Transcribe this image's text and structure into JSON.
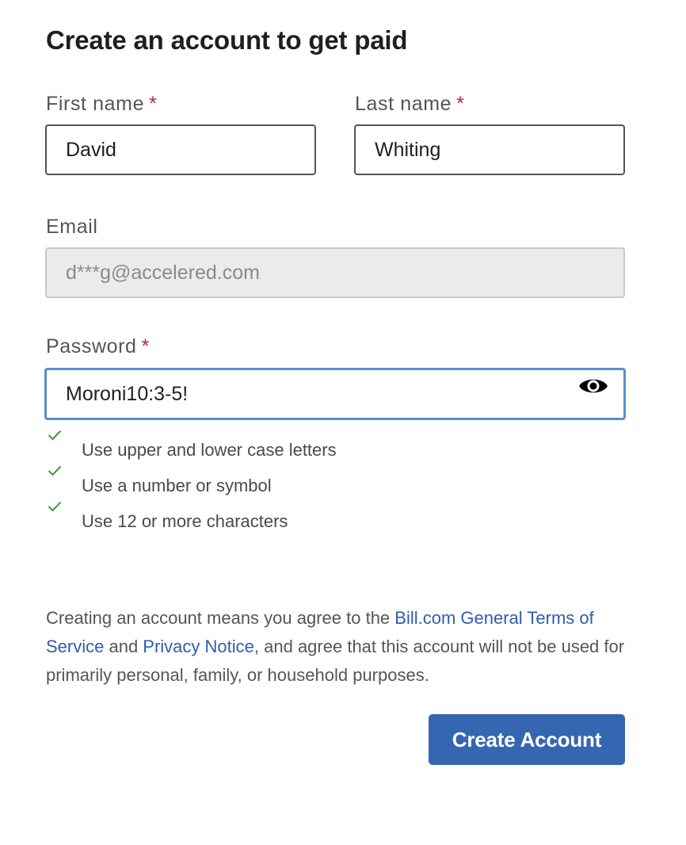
{
  "form": {
    "title": "Create an account to get paid",
    "required_marker": "*",
    "first_name": {
      "label": "First name",
      "value": "David"
    },
    "last_name": {
      "label": "Last name",
      "value": "Whiting"
    },
    "email": {
      "label": "Email",
      "value": "d***g@accelered.com"
    },
    "password": {
      "label": "Password",
      "value": "Moroni10:3-5!",
      "toggle_icon": "eye-icon"
    },
    "password_rules": [
      {
        "text": "Use upper and lower case letters",
        "met": true
      },
      {
        "text": "Use a number or symbol",
        "met": true
      },
      {
        "text": "Use 12 or more characters",
        "met": true
      }
    ],
    "legal": {
      "prefix": "Creating an account means you agree to the ",
      "terms_link": "Bill.com General Terms of Service",
      "middle": " and ",
      "privacy_link": "Privacy Notice,",
      "suffix": " and agree that this account will not be used for primarily personal, family, or household purposes."
    },
    "submit_label": "Create Account"
  },
  "colors": {
    "accent": "#3566b1",
    "link": "#2e5eaa",
    "required": "#c0262d",
    "check": "#3c9a3c",
    "focus_border": "#5a8ecf"
  }
}
